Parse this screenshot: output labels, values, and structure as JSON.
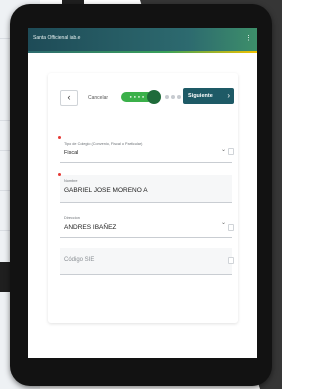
{
  "app": {
    "title": "Santa Officienal iab.e"
  },
  "toolbar": {
    "cancel_label": "Cancelar",
    "next_label": "Siguiente",
    "stepper_label": "● ● ● ●"
  },
  "form": {
    "school_type": {
      "label": "Tipo de Colegio (Convenio, Fiscal o Particular)",
      "value": "Fiscal"
    },
    "name": {
      "label": "Nombre",
      "value": "GABRIEL JOSE MORENO A"
    },
    "directorate": {
      "label": "Direccion",
      "value": "ANDRES IBAÑEZ"
    },
    "sie_code": {
      "placeholder": "Código SIE"
    }
  },
  "colors": {
    "accent": "#1e5a66",
    "step_done": "#3bb04a",
    "required": "#e53935"
  }
}
